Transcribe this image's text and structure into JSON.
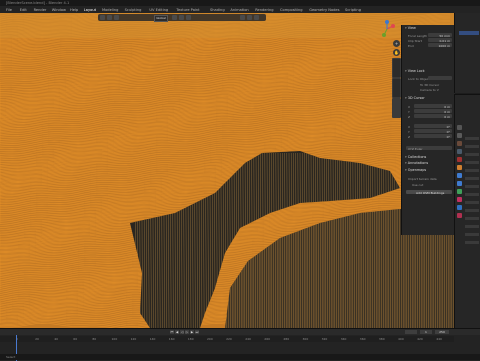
{
  "app": {
    "title": "[BlenderScene.blend] - Blender 4.1",
    "accent": "#4772b3",
    "wire_color": "#e8922a"
  },
  "menu": {
    "items": [
      "File",
      "Edit",
      "Render",
      "Window",
      "Help",
      "Layout",
      "Modeling",
      "Sculpting",
      "UV Editing",
      "Texture Paint",
      "Shading",
      "Animation",
      "Rendering",
      "Compositing",
      "Geometry Nodes",
      "Scripting"
    ],
    "active_index": 5
  },
  "viewport": {
    "mode": "Global",
    "shading": "wireframe"
  },
  "npanel": {
    "sections": {
      "view": "View",
      "view_lock": "View Lock",
      "3d_cursor": "3D Cursor",
      "collections": "Collections",
      "annotations": "Annotations",
      "openmaps": "Openmaps"
    },
    "view_fields": [
      {
        "label": "Focal Length",
        "value": "50 mm"
      },
      {
        "label": "Clip Start",
        "value": "0.01 m"
      },
      {
        "label": "End",
        "value": "1000 m"
      }
    ],
    "lock": {
      "label": "Lock to Object",
      "camera": "To 3D Cursor",
      "region": "Camera to V"
    },
    "cursor_location": [
      {
        "label": "X",
        "value": "0 m"
      },
      {
        "label": "Y",
        "value": "0 m"
      },
      {
        "label": "Z",
        "value": "0 m"
      }
    ],
    "cursor_rotation": [
      {
        "label": "X",
        "value": "0°"
      },
      {
        "label": "Y",
        "value": "0°"
      },
      {
        "label": "Z",
        "value": "0°"
      }
    ],
    "rotation_mode": "XYZ Euler",
    "openmaps": {
      "label": "Import terrain data",
      "checkbox": "Use cut",
      "button": "Add OSM Buildings"
    }
  },
  "timeline": {
    "ticks": [
      "0",
      "20",
      "40",
      "60",
      "80",
      "100",
      "120",
      "140",
      "160",
      "180",
      "200",
      "220",
      "240",
      "260",
      "280",
      "300",
      "320",
      "340",
      "360",
      "380",
      "400",
      "420",
      "440"
    ],
    "start": "1",
    "end": "250"
  },
  "status": {
    "text": "Select"
  }
}
